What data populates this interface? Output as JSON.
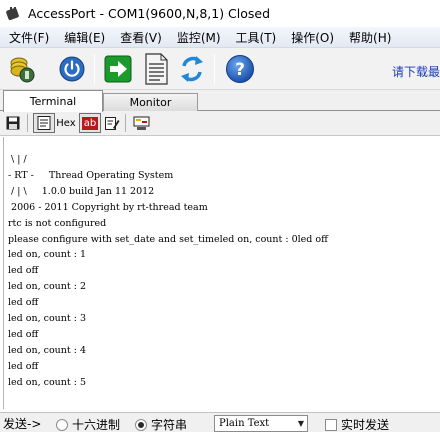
{
  "window": {
    "title": "AccessPort - COM1(9600,N,8,1) Closed"
  },
  "menu": {
    "items": [
      "文件(F)",
      "编辑(E)",
      "查看(V)",
      "监控(M)",
      "工具(T)",
      "操作(O)",
      "帮助(H)"
    ]
  },
  "toolbar": {
    "download_link": "请下载最",
    "icons": [
      "connect-coins-icon",
      "power-icon",
      "green-arrow-icon",
      "document-icon",
      "refresh-icon",
      "help-icon"
    ]
  },
  "tabs": [
    {
      "label": "Terminal",
      "active": true
    },
    {
      "label": "Monitor",
      "active": false
    }
  ],
  "subtoolbar": {
    "hex_label": "Hex",
    "ab_label": "ab"
  },
  "terminal": {
    "lines": [
      " \\ | /",
      "- RT -     Thread Operating System",
      " / | \\     1.0.0 build Jan 11 2012",
      " 2006 - 2011 Copyright by rt-thread team",
      "rtc is not configured",
      "please configure with set_date and set_timeled on, count : 0led off",
      "led on, count : 1",
      "led off",
      "led on, count : 2",
      "led off",
      "led on, count : 3",
      "led off",
      "led on, count : 4",
      "led off",
      "led on, count : 5"
    ]
  },
  "statusbar": {
    "send_label": "发送->",
    "hex_option": "十六进制",
    "string_option": "字符串",
    "selected_option": "string",
    "format_value": "Plain Text",
    "realtime_label": "实时发送"
  },
  "colors": {
    "link": "#1a3fb0",
    "menubar": "#e3e9f3",
    "help_blue": "#1f5fb8",
    "arrow_green": "#1d9a2c"
  }
}
